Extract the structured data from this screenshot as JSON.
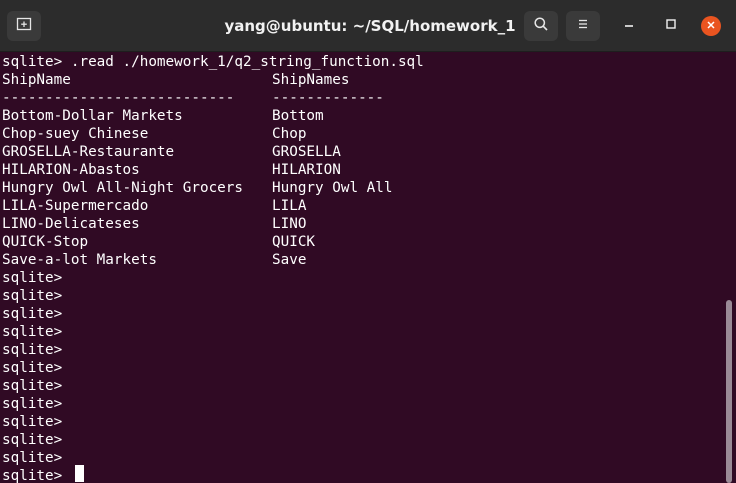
{
  "window": {
    "title": "yang@ubuntu: ~/SQL/homework_1"
  },
  "toolbar": {
    "new_tab_icon": "new-tab-icon",
    "search_icon": "search-icon",
    "menu_icon": "hamburger-menu-icon",
    "minimize_icon": "minimize-icon",
    "maximize_icon": "maximize-icon",
    "close_icon": "close-icon"
  },
  "colors": {
    "terminal_bg": "#300a24",
    "titlebar_bg": "#2c2c2c",
    "close_accent": "#e95420",
    "text": "#ffffff"
  },
  "terminal": {
    "command_line": "sqlite> .read ./homework_1/q2_string_function.sql",
    "header": {
      "col1": "ShipName",
      "col2": "ShipNames"
    },
    "separator": {
      "col1": "---------------------------",
      "col2": "-------------"
    },
    "rows": [
      {
        "ship_name": "Bottom-Dollar Markets",
        "ship_names": "Bottom"
      },
      {
        "ship_name": "Chop-suey Chinese",
        "ship_names": "Chop"
      },
      {
        "ship_name": "GROSELLA-Restaurante",
        "ship_names": "GROSELLA"
      },
      {
        "ship_name": "HILARION-Abastos",
        "ship_names": "HILARION"
      },
      {
        "ship_name": "Hungry Owl All-Night Grocers",
        "ship_names": "Hungry Owl All"
      },
      {
        "ship_name": "LILA-Supermercado",
        "ship_names": "LILA"
      },
      {
        "ship_name": "LINO-Delicateses",
        "ship_names": "LINO"
      },
      {
        "ship_name": "QUICK-Stop",
        "ship_names": "QUICK"
      },
      {
        "ship_name": "Save-a-lot Markets",
        "ship_names": "Save"
      }
    ],
    "prompts": [
      "sqlite>",
      "sqlite>",
      "sqlite>",
      "sqlite>",
      "sqlite>",
      "sqlite>",
      "sqlite>",
      "sqlite>",
      "sqlite>",
      "sqlite>",
      "sqlite>",
      "sqlite>"
    ]
  }
}
